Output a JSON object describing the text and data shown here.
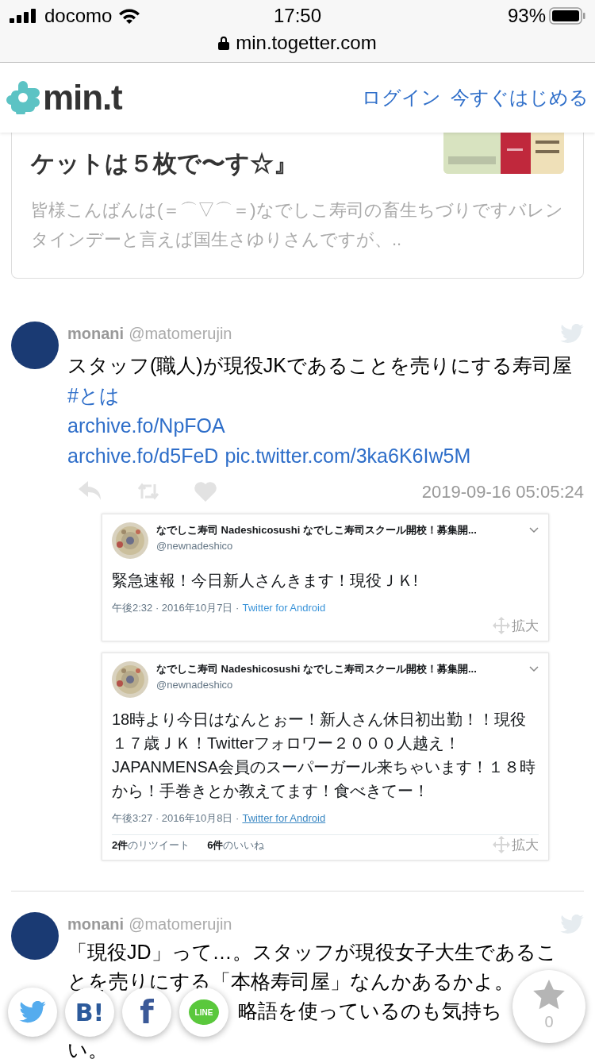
{
  "status_bar": {
    "carrier": "docomo",
    "time": "17:50",
    "battery": "93%"
  },
  "address_bar": {
    "url": "min.togetter.com"
  },
  "header": {
    "logo": "min.t",
    "links": [
      "ログイン",
      "今すぐはじめる"
    ]
  },
  "related_card": {
    "title": "ケットは５枚で〜す☆』",
    "description": "皆様こんばんは(＝⌒▽⌒＝)なでしこ寿司の畜生ちづりですバレンタインデーと言えば国生さゆりさんですが、.."
  },
  "tweet": {
    "name": "monani",
    "handle": "@matomerujin",
    "text": "スタッフ(職人)が現役JKであることを売りにする寿司屋",
    "hashtag": "#とは",
    "links": [
      "archive.fo/NpFOA",
      "archive.fo/d5FeD",
      "pic.twitter.com/3ka6K6Iw5M"
    ],
    "timestamp": "2019-09-16 05:05:24",
    "embeds": [
      {
        "name": "なでしこ寿司 Nadeshicosushi なでしこ寿司スクール開校！募集開...",
        "handle": "@newnadeshico",
        "text": "緊急速報！今日新人さんきます！現役ＪＫ!",
        "meta": "午後2:32 · 2016年10月7日 ·",
        "source": "Twitter for Android",
        "underlined": false,
        "zoom": "拡大"
      },
      {
        "name": "なでしこ寿司 Nadeshicosushi なでしこ寿司スクール開校！募集開...",
        "handle": "@newnadeshico",
        "text": "18時より今日はなんとぉー！新人さん休日初出勤！！現役１７歳ＪＫ！Twitterフォロワー２０００人越え！JAPANMENSA会員のスーパーガール来ちゃいます！１８時から！手巻きとか教えてます！食べきてー！",
        "meta": "午後3:27 · 2016年10月8日 ·",
        "source": "Twitter for Android",
        "underlined": true,
        "zoom": "拡大",
        "stats": [
          {
            "count": "2件",
            "label": "のリツイート"
          },
          {
            "count": "6件",
            "label": "のいいね"
          }
        ]
      }
    ]
  },
  "tweet2": {
    "name": "monani",
    "handle": "@matomerujin",
    "lines": [
      "「現役JD」って…。スタッフが現役女子大生であるこ",
      "とを売りにする「本格寿司屋」なんかあるかよ。",
      "略語を使っているのも気持ち",
      "い。"
    ]
  },
  "share_buttons": [
    {
      "kind": "twitter"
    },
    {
      "kind": "hatena",
      "label": "B!"
    },
    {
      "kind": "facebook",
      "label": "f"
    },
    {
      "kind": "line",
      "label": "LINE"
    }
  ],
  "favorite": {
    "count": "0"
  }
}
